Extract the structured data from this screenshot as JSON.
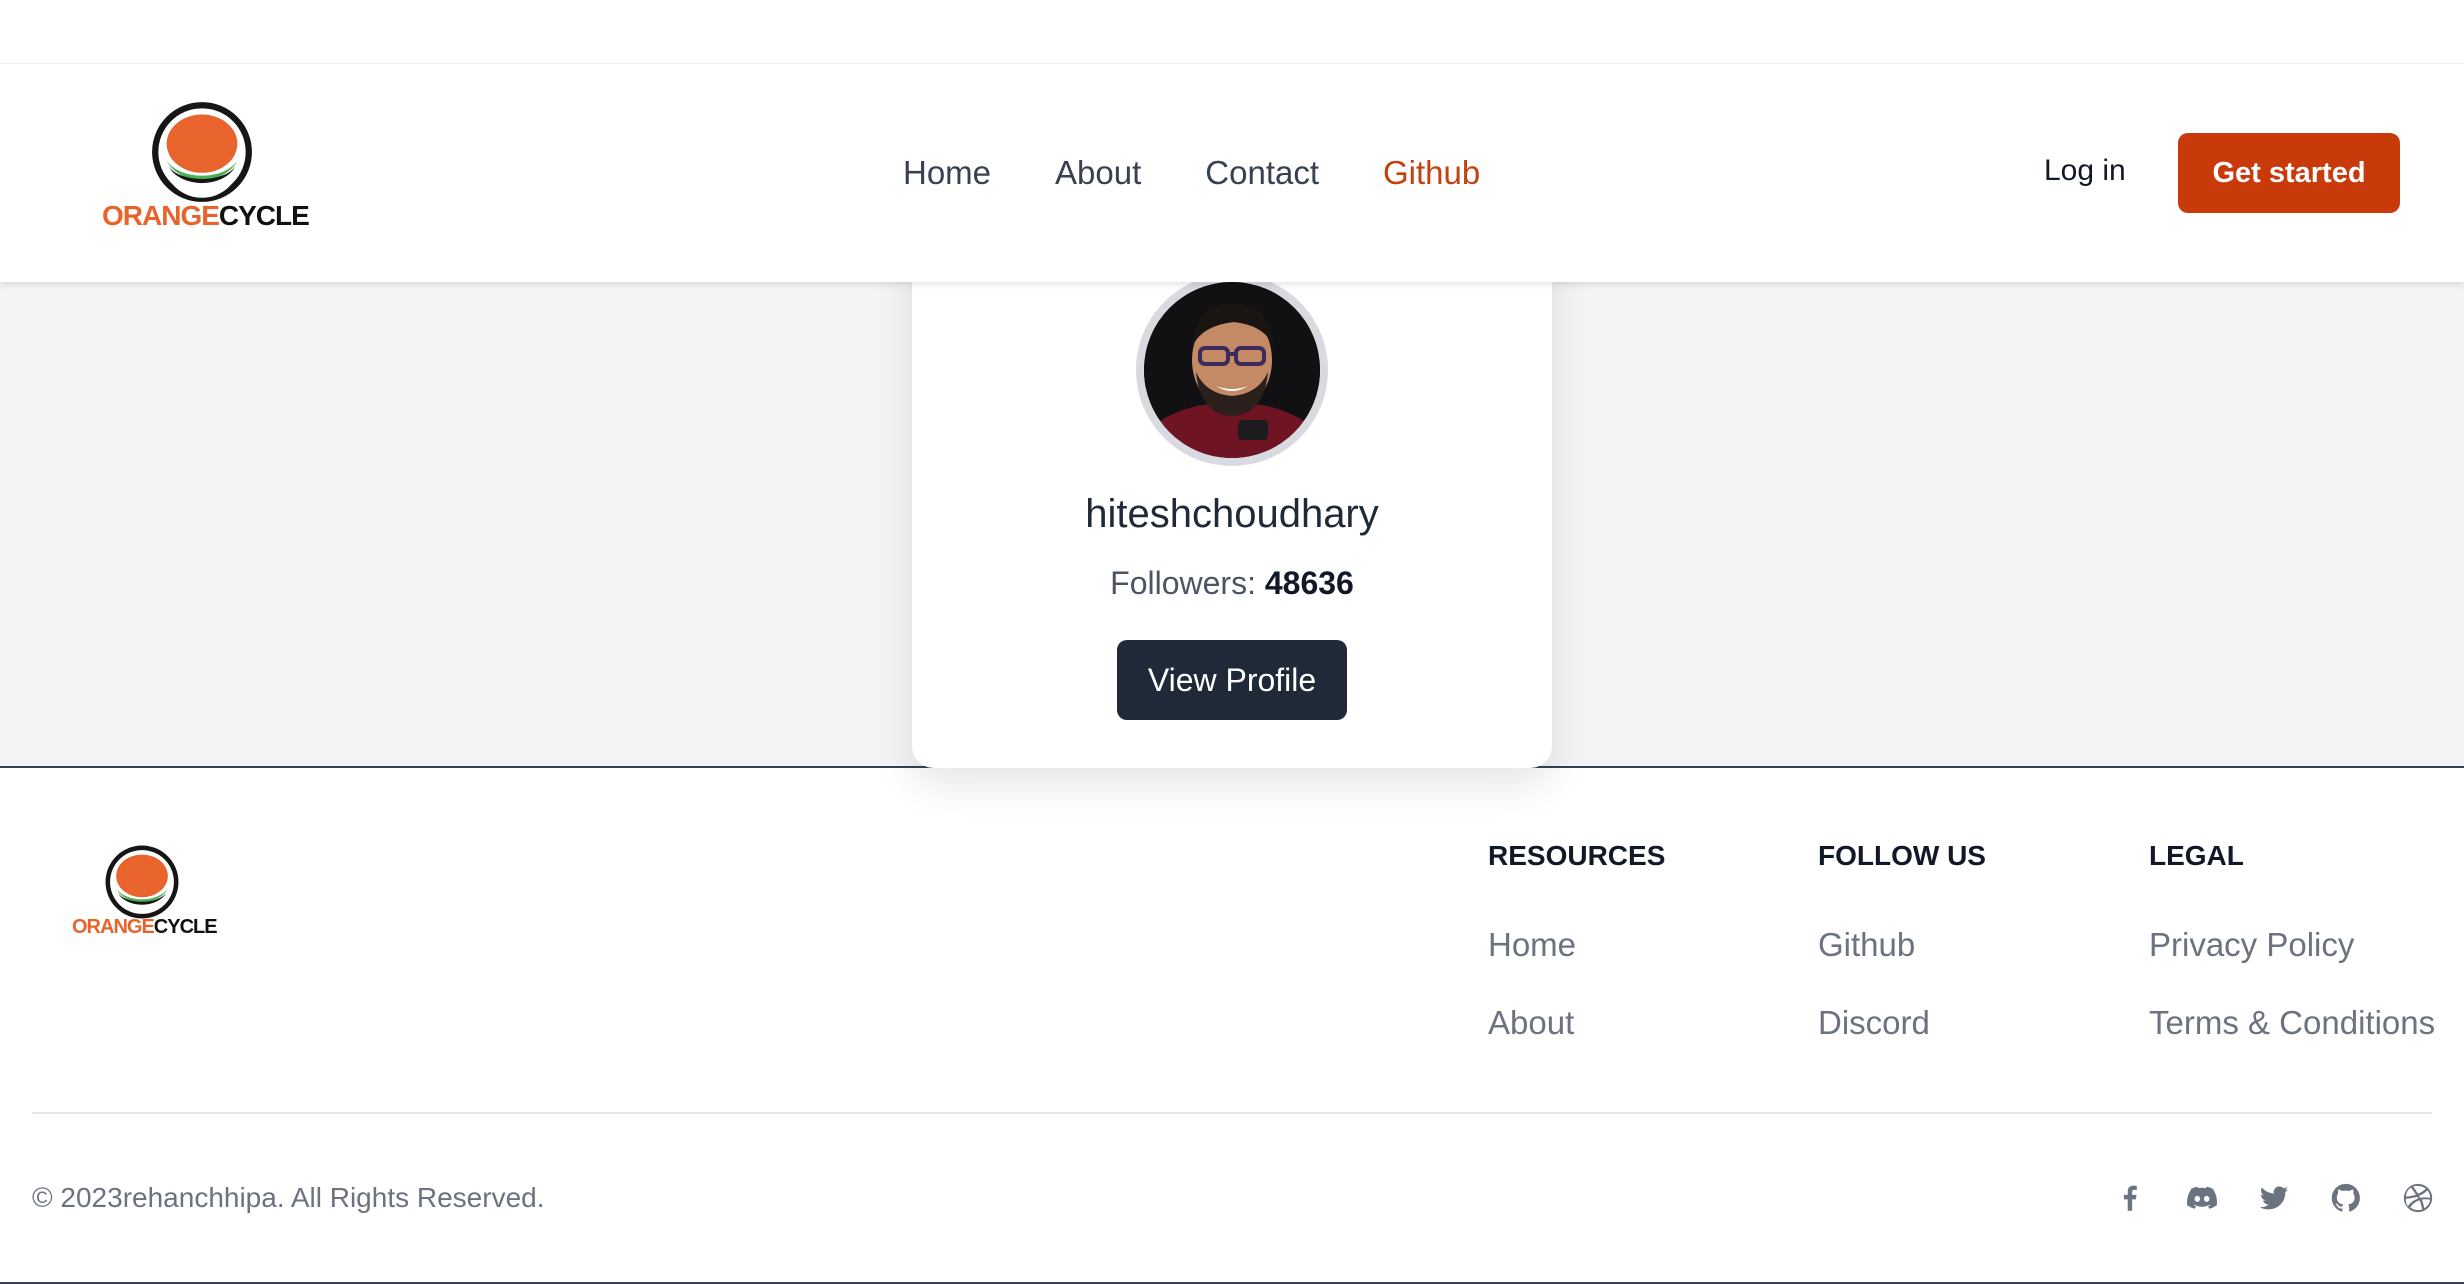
{
  "brand": {
    "word_part1": "ORANGE",
    "word_part2": "CYCLE",
    "colors": {
      "orange": "#e8642c",
      "green": "#4caf50",
      "dark": "#111111"
    }
  },
  "nav": {
    "items": [
      {
        "label": "Home",
        "active": false
      },
      {
        "label": "About",
        "active": false
      },
      {
        "label": "Contact",
        "active": false
      },
      {
        "label": "Github",
        "active": true
      }
    ],
    "login_label": "Log in",
    "cta_label": "Get started",
    "cta_color": "#c93a0b"
  },
  "profile": {
    "username": "hiteshchoudhary",
    "followers_label": "Followers:",
    "followers_count": "48636",
    "button_label": "View Profile"
  },
  "footer": {
    "columns": [
      {
        "heading": "RESOURCES",
        "links": [
          "Home",
          "About"
        ]
      },
      {
        "heading": "FOLLOW US",
        "links": [
          "Github",
          "Discord"
        ]
      },
      {
        "heading": "LEGAL",
        "links": [
          "Privacy Policy",
          "Terms & Conditions"
        ]
      }
    ],
    "copyright": "© 2023rehanchhipa. All Rights Reserved.",
    "social_icons": [
      "facebook-icon",
      "discord-icon",
      "twitter-icon",
      "github-icon",
      "dribbble-icon"
    ]
  }
}
